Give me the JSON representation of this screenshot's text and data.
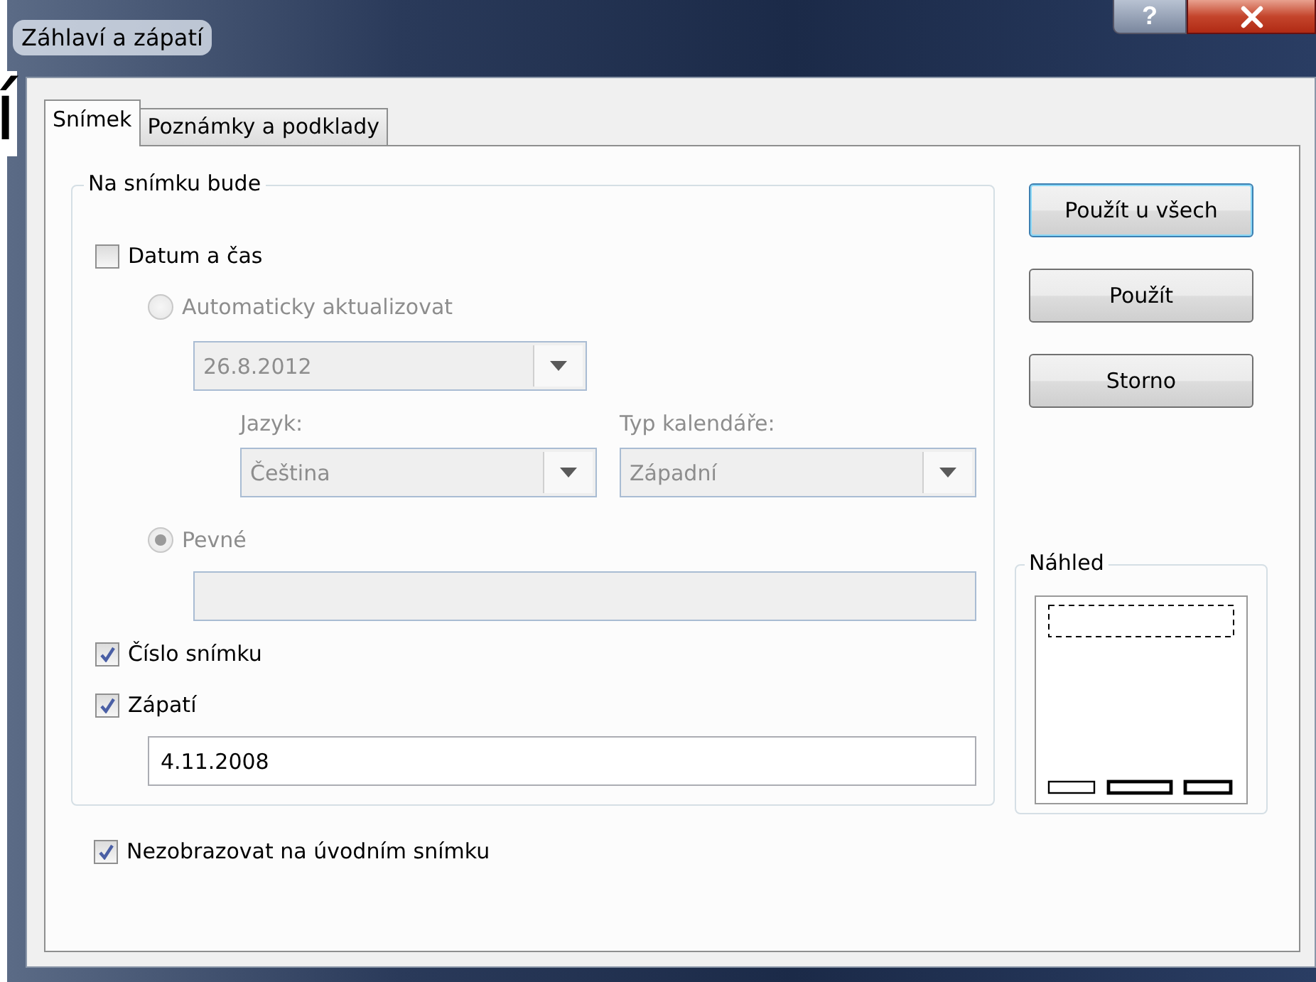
{
  "background_text": "í",
  "window": {
    "title": "Záhlaví a zápatí",
    "help_button": "?"
  },
  "tabs": [
    {
      "label": "Snímek",
      "selected": true
    },
    {
      "label": "Poznámky a podklady",
      "selected": false
    }
  ],
  "group": {
    "title": "Na snímku bude",
    "items": [
      {
        "kind": "checkbox",
        "label": "Datum a čas",
        "checked": false,
        "children": [
          {
            "kind": "radio",
            "label": "Automaticky aktualizovat",
            "selected": false,
            "disabled": true,
            "children": [
              {
                "kind": "combo",
                "value": "26.8.2012",
                "disabled": true
              },
              {
                "kind": "combo_pair",
                "combos": [
                  {
                    "label": "Jazyk:",
                    "value": "Čeština",
                    "disabled": true
                  },
                  {
                    "label": "Typ kalendáře:",
                    "value": "Západní",
                    "disabled": true
                  }
                ]
              }
            ]
          },
          {
            "kind": "radio",
            "label": "Pevné",
            "selected": true,
            "disabled": true,
            "children": [
              {
                "kind": "field",
                "disabled": true
              }
            ]
          }
        ]
      },
      {
        "kind": "checkbox",
        "label": "Číslo snímku",
        "checked": true
      },
      {
        "kind": "checkbox",
        "label": "Zápatí",
        "checked": true,
        "children": [
          {
            "kind": "field",
            "value": "4.11.2008",
            "disabled": false
          }
        ]
      }
    ]
  },
  "after_group": [
    {
      "kind": "checkbox",
      "label": "Nezobrazovat na úvodním snímku",
      "checked": true
    }
  ],
  "buttons": [
    {
      "label": "Použít u všech",
      "default": true
    },
    {
      "label": "Použít",
      "default": false
    },
    {
      "label": "Storno",
      "default": false
    }
  ],
  "preview": {
    "title": "Náhled"
  }
}
